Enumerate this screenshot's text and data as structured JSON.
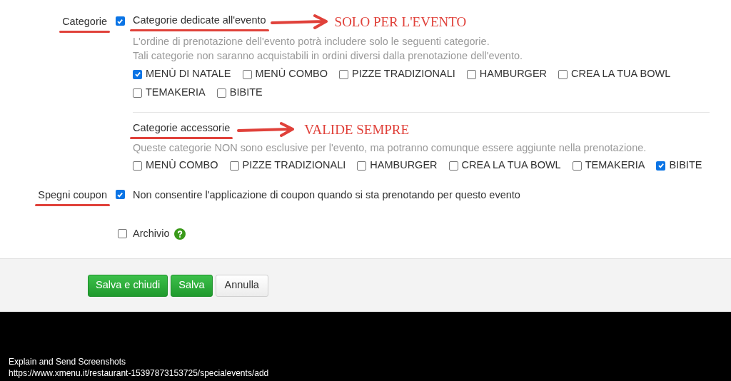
{
  "sections": [
    {
      "label": "Categorie",
      "label_underlined": true,
      "checked": true,
      "title": "Categorie dedicate all'evento",
      "title_underlined": true,
      "annotation": "SOLO PER L'EVENTO",
      "description": [
        "L'ordine di prenotazione dell'evento potrà includere solo le seguenti categorie.",
        "Tali categorie non saranno acquistabili in ordini diversi dalla prenotazione dell'evento."
      ],
      "options": [
        {
          "label": "MENÙ DI NATALE",
          "checked": true
        },
        {
          "label": "MENÙ COMBO",
          "checked": false
        },
        {
          "label": "PIZZE TRADIZIONALI",
          "checked": false
        },
        {
          "label": "HAMBURGER",
          "checked": false
        },
        {
          "label": "CREA LA TUA BOWL",
          "checked": false
        },
        {
          "label": "TEMAKERIA",
          "checked": false
        },
        {
          "label": "BIBITE",
          "checked": false
        }
      ],
      "sub": {
        "title": "Categorie accessorie",
        "title_underlined": true,
        "annotation": "VALIDE SEMPRE",
        "description": [
          "Queste categorie NON sono esclusive per l'evento, ma potranno comunque essere aggiunte nella prenotazione."
        ],
        "options": [
          {
            "label": "MENÙ COMBO",
            "checked": false
          },
          {
            "label": "PIZZE TRADIZIONALI",
            "checked": false
          },
          {
            "label": "HAMBURGER",
            "checked": false
          },
          {
            "label": "CREA LA TUA BOWL",
            "checked": false
          },
          {
            "label": "TEMAKERIA",
            "checked": false
          },
          {
            "label": "BIBITE",
            "checked": true
          }
        ]
      }
    },
    {
      "label": "Spegni coupon",
      "label_underlined": true,
      "checked": true,
      "text": "Non consentire l'applicazione di coupon quando si sta prenotando per questo evento"
    }
  ],
  "archive": {
    "label": "Archivio",
    "checked": false
  },
  "buttons": [
    {
      "label": "Salva e chiudi",
      "kind": "primary"
    },
    {
      "label": "Salva",
      "kind": "primary"
    },
    {
      "label": "Annulla",
      "kind": "default"
    }
  ],
  "overlay": [
    "Explain and Send Screenshots",
    "https://www.xmenu.it/restaurant-15397873153725/specialevents/add"
  ]
}
